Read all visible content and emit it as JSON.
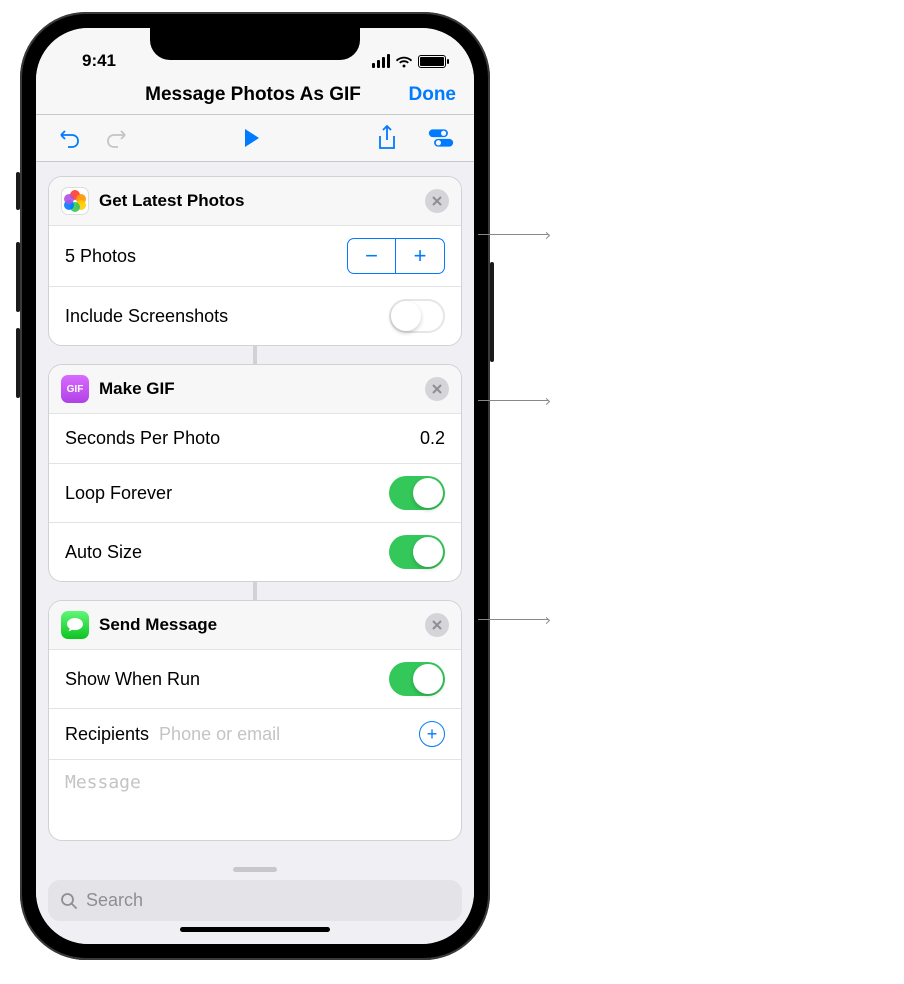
{
  "status": {
    "time": "9:41"
  },
  "nav": {
    "title": "Message Photos As GIF",
    "done": "Done"
  },
  "actions": {
    "getPhotos": {
      "title": "Get Latest Photos",
      "countLabel": "5 Photos",
      "includeScreenshotsLabel": "Include Screenshots",
      "includeScreenshots": false
    },
    "makeGif": {
      "title": "Make GIF",
      "secondsLabel": "Seconds Per Photo",
      "secondsValue": "0.2",
      "loopLabel": "Loop Forever",
      "loop": true,
      "autoSizeLabel": "Auto Size",
      "autoSize": true
    },
    "sendMessage": {
      "title": "Send Message",
      "showWhenRunLabel": "Show When Run",
      "showWhenRun": true,
      "recipientsLabel": "Recipients",
      "recipientsPlaceholder": "Phone or email",
      "messagePlaceholder": "Message"
    }
  },
  "search": {
    "placeholder": "Search"
  }
}
